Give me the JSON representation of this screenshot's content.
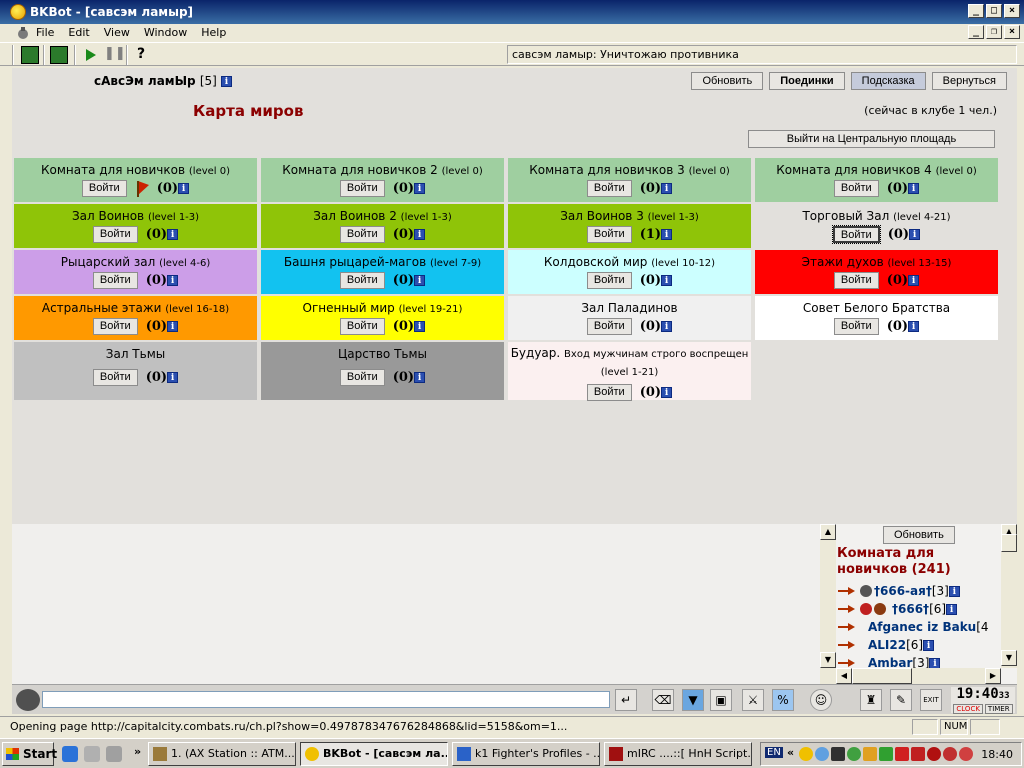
{
  "window": {
    "title": "BKBot - [савсэм ламыр]"
  },
  "menu": [
    "File",
    "Edit",
    "View",
    "Window",
    "Help"
  ],
  "toolbar": {
    "status_text": "савсэм ламыр: Уничтожаю противника"
  },
  "page": {
    "nick": "сАвсЭм ламЫр",
    "level": "[5]",
    "buttons": {
      "refresh": "Обновить",
      "duels": "Поединки",
      "hint": "Подсказка",
      "back": "Вернуться"
    },
    "title": "Карта миров",
    "club_count": "(сейчас в клубе 1 чел.)",
    "central_square": "Выйти на Центральную площадь",
    "enter_label": "Войти",
    "rooms": [
      {
        "name": "Комната для новичков",
        "level": "(level 0)",
        "count": "(0)",
        "bg": "#9fcfa0"
      },
      {
        "name": "Комната для новичков 2",
        "level": "(level 0)",
        "count": "(0)",
        "bg": "#9fcfa0"
      },
      {
        "name": "Комната для новичков 3",
        "level": "(level 0)",
        "count": "(0)",
        "bg": "#9fcfa0"
      },
      {
        "name": "Комната для новичков 4",
        "level": "(level 0)",
        "count": "(0)",
        "bg": "#9fcfa0"
      },
      {
        "name": "Зал Воинов",
        "level": "(level 1-3)",
        "count": "(0)",
        "bg": "#8fc408"
      },
      {
        "name": "Зал Воинов 2",
        "level": "(level 1-3)",
        "count": "(0)",
        "bg": "#8fc408"
      },
      {
        "name": "Зал Воинов 3",
        "level": "(level 1-3)",
        "count": "(1)",
        "bg": "#8fc408"
      },
      {
        "name": "Торговый Зал",
        "level": "(level 4-21)",
        "count": "(0)",
        "bg": "#e2e0dc"
      },
      {
        "name": "Рыцарский зал",
        "level": "(level 4-6)",
        "count": "(0)",
        "bg": "#cc9ee8"
      },
      {
        "name": "Башня рыцарей-магов",
        "level": "(level 7-9)",
        "count": "(0)",
        "bg": "#12c2f0"
      },
      {
        "name": "Колдовской мир",
        "level": "(level 10-12)",
        "count": "(0)",
        "bg": "#ccffff"
      },
      {
        "name": "Этажи духов",
        "level": "(level 13-15)",
        "count": "(0)",
        "bg": "#ff0000"
      },
      {
        "name": "Астральные этажи",
        "level": "(level 16-18)",
        "count": "(0)",
        "bg": "#ff9900"
      },
      {
        "name": "Огненный мир",
        "level": "(level 19-21)",
        "count": "(0)",
        "bg": "#ffff00"
      },
      {
        "name": "Зал Паладинов",
        "level": "",
        "count": "(0)",
        "bg": "#f0f0f0"
      },
      {
        "name": "Совет Белого Братства",
        "level": "",
        "count": "(0)",
        "bg": "#ffffff"
      },
      {
        "name": "Зал Тьмы",
        "level": "",
        "count": "(0)",
        "bg": "#c0c0c0"
      },
      {
        "name": "Царство Тьмы",
        "level": "",
        "count": "(0)",
        "bg": "#999999"
      },
      {
        "name": "Будуар.",
        "sub": "Вход мужчинам строго воспрещен",
        "level": "(level 1-21)",
        "count": "(0)",
        "bg": "#fbf0f0"
      }
    ]
  },
  "side": {
    "refresh": "Обновить",
    "room_title": "Комната для новичков (241)",
    "users": [
      {
        "name": "†666-ая†",
        "level": "[3]"
      },
      {
        "name": "†666†",
        "level": "[6]"
      },
      {
        "name": "Afganec iz Baku",
        "level": "[4"
      },
      {
        "name": "ALI22",
        "level": "[6]"
      },
      {
        "name": "Ambar",
        "level": "[3]"
      }
    ]
  },
  "clock": {
    "time": "19:40",
    "sec": "33",
    "clock_label": "CLOCK",
    "timer_label": "TIMER"
  },
  "statusbar": {
    "text": "Opening page http://capitalcity.combats.ru/ch.pl?show=0.497878347676284868&lid=5158&om=1...",
    "num": "NUM"
  },
  "taskbar": {
    "start": "Start",
    "tasks": [
      "1. (AX Station :: ATM...",
      "BKBot - [савсэм ла...",
      "k1 Fighter's Profiles - ...",
      "mIRC ....::[ HnH Script..."
    ],
    "lang": "EN",
    "time": "18:40"
  }
}
